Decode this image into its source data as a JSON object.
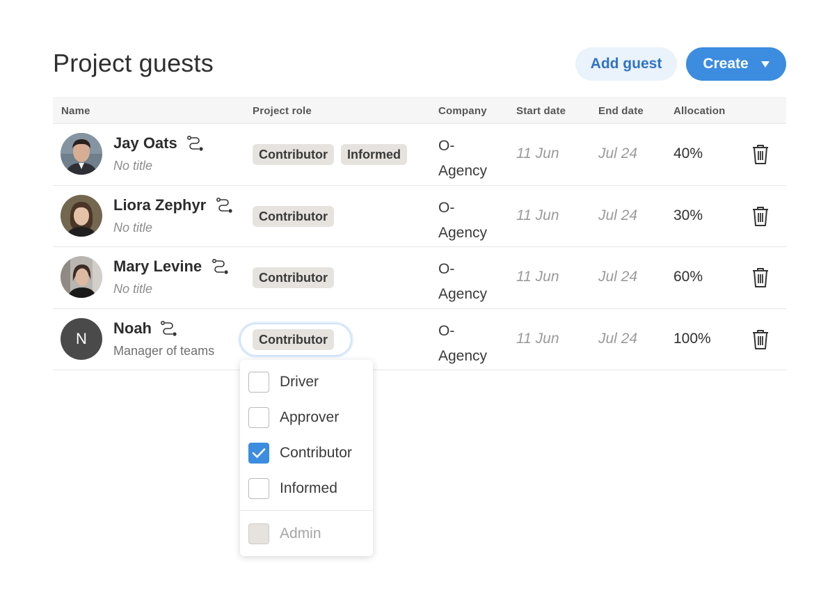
{
  "page": {
    "title": "Project guests"
  },
  "actions": {
    "add_guest": "Add guest",
    "create": "Create"
  },
  "table": {
    "headers": {
      "name": "Name",
      "role": "Project role",
      "company": "Company",
      "start": "Start date",
      "end": "End date",
      "allocation": "Allocation"
    },
    "rows": [
      {
        "name": "Jay Oats",
        "subtitle": "No title",
        "roles": [
          "Contributor",
          "Informed"
        ],
        "company": "O-\nAgency",
        "start": "11 Jun",
        "end": "Jul 24",
        "allocation": "40%"
      },
      {
        "name": "Liora Zephyr",
        "subtitle": "No title",
        "roles": [
          "Contributor"
        ],
        "company": "O-\nAgency",
        "start": "11 Jun",
        "end": "Jul 24",
        "allocation": "30%"
      },
      {
        "name": "Mary Levine",
        "subtitle": "No title",
        "roles": [
          "Contributor"
        ],
        "company": "O-\nAgency",
        "start": "11 Jun",
        "end": "Jul 24",
        "allocation": "60%"
      },
      {
        "name": "Noah",
        "initial": "N",
        "subtitle": "Manager of teams",
        "roles": [
          "Contributor"
        ],
        "company": "O-\nAgency",
        "start": "11 Jun",
        "end": "Jul 24",
        "allocation": "100%"
      }
    ]
  },
  "role_menu": {
    "options": [
      {
        "label": "Driver",
        "checked": false
      },
      {
        "label": "Approver",
        "checked": false
      },
      {
        "label": "Contributor",
        "checked": true
      },
      {
        "label": "Informed",
        "checked": false
      }
    ],
    "admin": {
      "label": "Admin",
      "disabled": true
    }
  },
  "colors": {
    "accent": "#3c8ce0",
    "chip_bg": "#e6e3df",
    "add_guest_bg": "#eaf2fb"
  },
  "icons": {
    "link": "route-icon",
    "delete": "trash-icon",
    "check": "check-icon"
  }
}
